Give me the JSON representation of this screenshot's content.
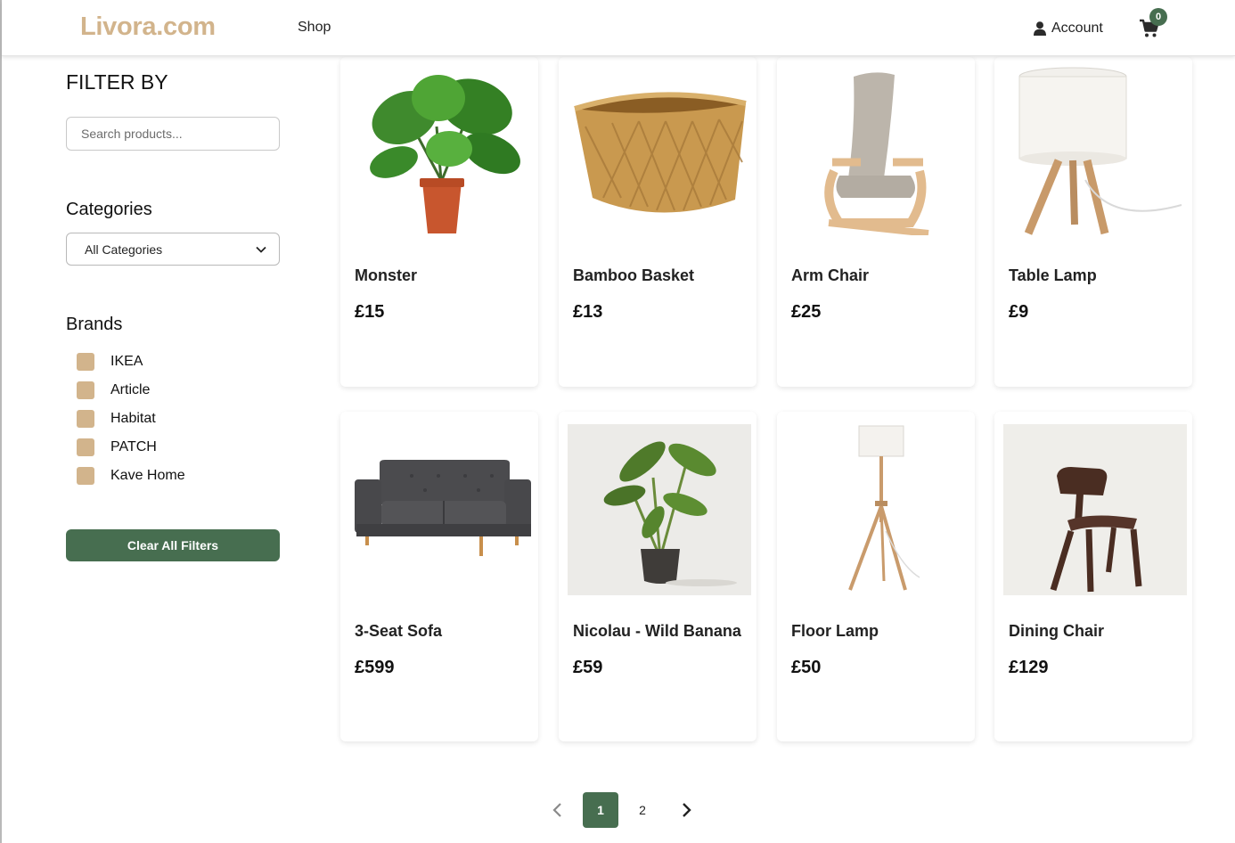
{
  "header": {
    "logo": "Livora.com",
    "nav_shop": "Shop",
    "account_label": "Account",
    "cart_count": "0"
  },
  "sidebar": {
    "filter_title": "FILTER BY",
    "search_placeholder": "Search products...",
    "categories_title": "Categories",
    "category_selected": "All Categories",
    "brands_title": "Brands",
    "brands": [
      "IKEA",
      "Article",
      "Habitat",
      "PATCH",
      "Kave Home"
    ],
    "clear_button": "Clear All Filters"
  },
  "products": [
    {
      "name": "Monster",
      "price": "£15",
      "icon": "monstera-plant-icon"
    },
    {
      "name": "Bamboo Basket",
      "price": "£13",
      "icon": "bamboo-basket-icon"
    },
    {
      "name": "Arm Chair",
      "price": "£25",
      "icon": "arm-chair-icon"
    },
    {
      "name": "Table Lamp",
      "price": "£9",
      "icon": "table-lamp-icon"
    },
    {
      "name": "3-Seat Sofa",
      "price": "£599",
      "icon": "sofa-icon"
    },
    {
      "name": "Nicolau - Wild Banana",
      "price": "£59",
      "icon": "banana-plant-icon"
    },
    {
      "name": "Floor Lamp",
      "price": "£50",
      "icon": "floor-lamp-icon"
    },
    {
      "name": "Dining Chair",
      "price": "£129",
      "icon": "dining-chair-icon"
    }
  ],
  "pagination": {
    "pages": [
      "1",
      "2"
    ],
    "current": "1"
  },
  "colors": {
    "brand": "#d2b48c",
    "accent": "#476e50"
  }
}
